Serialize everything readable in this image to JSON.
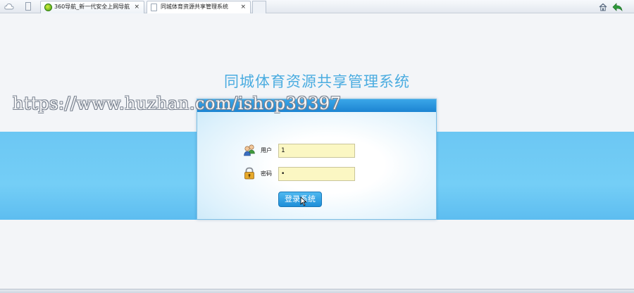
{
  "browser": {
    "tabs": [
      {
        "title": "360导航_新一代安全上网导航",
        "close": "×"
      },
      {
        "title": "同城体育资源共享管理系统",
        "close": "×"
      }
    ]
  },
  "page": {
    "system_title": "同城体育资源共享管理系统",
    "watermark": "https://www.huzhan.com/ishop39397",
    "login": {
      "username_label": "用户",
      "username_value": "1",
      "password_label": "密码",
      "password_value": "•",
      "submit_label": "登录系统"
    }
  },
  "colors": {
    "accent": "#4aace0",
    "band": "#6cc7f3",
    "input_bg": "#fbf7c3"
  },
  "icons": [
    "cloud-icon",
    "page-icon",
    "home-icon",
    "back-arrow-icon",
    "users-icon",
    "lock-icon",
    "cursor-icon"
  ]
}
